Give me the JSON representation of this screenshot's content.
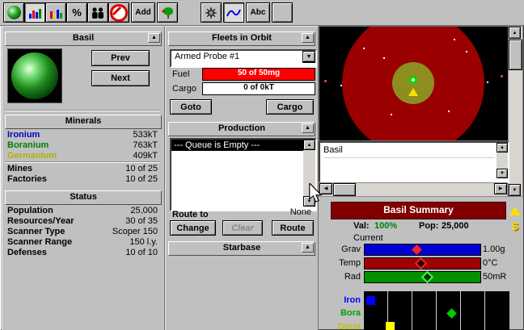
{
  "icons": {
    "collapse": "▲",
    "up": "▲",
    "down": "▼",
    "left": "◀",
    "right": "▶",
    "dropdown": "▼"
  },
  "toolbar": {
    "percent_label": "%",
    "add_label": "Add",
    "abc_label": "Abc"
  },
  "planet_panel": {
    "title": "Basil",
    "prev_label": "Prev",
    "next_label": "Next",
    "minerals": {
      "header": "Minerals",
      "rows": [
        {
          "label": "Ironium",
          "value": "533kT"
        },
        {
          "label": "Boranium",
          "value": "763kT"
        },
        {
          "label": "Germanium",
          "value": "409kT"
        },
        {
          "label": "Mines",
          "value": "10 of 25"
        },
        {
          "label": "Factories",
          "value": "10 of 25"
        }
      ]
    },
    "status": {
      "header": "Status",
      "rows": [
        {
          "label": "Population",
          "value": "25,000"
        },
        {
          "label": "Resources/Year",
          "value": "30 of 35"
        },
        {
          "label": "Scanner Type",
          "value": "Scoper 150"
        },
        {
          "label": "Scanner Range",
          "value": "150 l.y."
        },
        {
          "label": "Defenses",
          "value": "10 of 10"
        }
      ]
    }
  },
  "fleets_panel": {
    "title": "Fleets in Orbit",
    "fleet_select": "Armed Probe #1",
    "fuel_label": "Fuel",
    "fuel_value": "50 of 50mg",
    "fuel_percent": 100,
    "cargo_label": "Cargo",
    "cargo_value": "0 of 0kT",
    "goto_label": "Goto",
    "cargo_button": "Cargo"
  },
  "production_panel": {
    "title": "Production",
    "queue": [
      "--- Queue is Empty ---"
    ],
    "route_to_label": "Route to",
    "route_value": "None",
    "change_label": "Change",
    "clear_label": "Clear",
    "route_label": "Route"
  },
  "starbase_panel": {
    "title": "Starbase"
  },
  "scanner": {
    "planet_list": [
      "Basil"
    ]
  },
  "summary_panel": {
    "title": "Basil Summary",
    "val_label": "Val:",
    "val_value": "100%",
    "pop_label": "Pop:",
    "pop_value": "25,000",
    "dollar": "$",
    "current_label": "Current",
    "env": [
      {
        "label": "Grav",
        "value": "1.00g",
        "bar_color": "#0000d0",
        "marker": "red-solid-diamond",
        "marker_pos_pct": 42
      },
      {
        "label": "Temp",
        "value": "0°C",
        "bar_color": "#a00000",
        "marker": "red-outline-diamond",
        "marker_pos_pct": 45
      },
      {
        "label": "Rad",
        "value": "50mR",
        "bar_color": "#009000",
        "marker": "green-outline-diamond",
        "marker_pos_pct": 50
      }
    ],
    "minerals": [
      {
        "label": "Iron",
        "color": "#0000ff"
      },
      {
        "label": "Bora",
        "color": "#00a000"
      },
      {
        "label": "Germ",
        "color": "#c0c000"
      }
    ]
  },
  "colors": {
    "window_gray": "#c0c0c0",
    "summary_header_maroon": "#800000",
    "fuel_red": "#ff0000",
    "val_green": "#008000",
    "scanner_range_red": "#9a0000",
    "planet_scan_olive": "#8e8e20",
    "ironium_blue": "#0000cc",
    "boranium_green": "#008000",
    "germanium_yellow": "#b0b000"
  }
}
